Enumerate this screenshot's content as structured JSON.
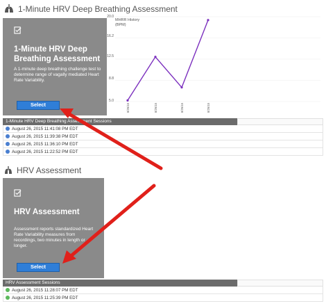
{
  "section1": {
    "title": "1-Minute HRV Deep Breathing Assessment",
    "panel": {
      "title": "1-Minute HRV Deep Breathing Assessment",
      "description": "A 1-minute deep breathing challenge test to determine range of vagally mediated Heart Rate Variability.",
      "select_label": "Select"
    },
    "chart_data": {
      "type": "line",
      "title": "MHRR History (BPM)",
      "x": [
        "8/26/15",
        "8/26/15",
        "8/26/15",
        "8/26/15"
      ],
      "values": [
        5.2,
        12.9,
        7.5,
        19.4
      ],
      "ylim": [
        5.0,
        20.0
      ],
      "yticks": [
        "20.0",
        "16.2",
        "12.5",
        "8.8",
        "5.0"
      ],
      "color": "#7b2fbe"
    },
    "sessions_label": "1-Minute HRV Deep Breathing Assessment Sessions",
    "sessions": [
      "August 26, 2015 11:41:08 PM EDT",
      "August 26, 2015 11:39:38 PM EDT",
      "August 26, 2015 11:36:10 PM EDT",
      "August 26, 2015 11:22:52 PM EDT"
    ]
  },
  "section2": {
    "title": "HRV Assessment",
    "panel": {
      "title": "HRV Assessment",
      "description": "Assessment reports standardized Heart Rate Variability measures from recordings, two minutes in length or longer.",
      "select_label": "Select"
    },
    "sessions_label": "HRV Assessment Sessions",
    "sessions": [
      "August 26, 2015 11:28:07 PM EDT",
      "August 26, 2015 11:25:39 PM EDT"
    ]
  },
  "colors": {
    "panel": "#8a8a8a",
    "button": "#2f7ed8",
    "bar": "#6b6b6b",
    "arrow": "#e0201a"
  }
}
